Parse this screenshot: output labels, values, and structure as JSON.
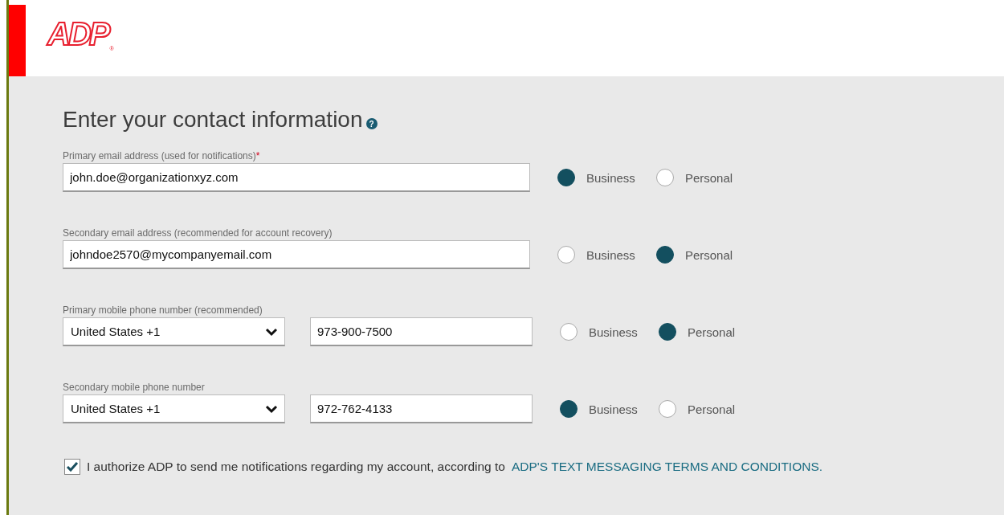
{
  "logo": {
    "text": "ADP",
    "mark": "®"
  },
  "heading": {
    "title": "Enter your contact information",
    "help_icon": "?"
  },
  "fields": [
    {
      "kind": "email",
      "label": "Primary email address (used for notifications)",
      "required_mark": "*",
      "value": "john.doe@organizationxyz.com",
      "options": [
        {
          "label": "Business",
          "selected": true
        },
        {
          "label": "Personal",
          "selected": false
        }
      ]
    },
    {
      "kind": "email",
      "label": "Secondary email address (recommended for account recovery)",
      "value": "johndoe2570@mycompanyemail.com",
      "options": [
        {
          "label": "Business",
          "selected": false
        },
        {
          "label": "Personal",
          "selected": true
        }
      ]
    },
    {
      "kind": "phone",
      "label": "Primary mobile phone number (recommended)",
      "country": "United States +1",
      "value": "973-900-7500",
      "options": [
        {
          "label": "Business",
          "selected": false
        },
        {
          "label": "Personal",
          "selected": true
        }
      ]
    },
    {
      "kind": "phone",
      "label": "Secondary mobile phone number",
      "country": "United States +1",
      "value": "972-762-4133",
      "options": [
        {
          "label": "Business",
          "selected": true
        },
        {
          "label": "Personal",
          "selected": false
        }
      ]
    }
  ],
  "consent": {
    "checked": true,
    "text": "I authorize ADP to send me notifications regarding my account, according to",
    "link": "ADP'S TEXT MESSAGING TERMS AND CONDITIONS."
  }
}
